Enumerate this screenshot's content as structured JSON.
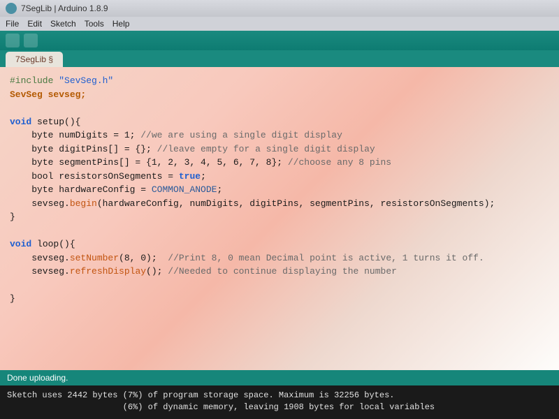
{
  "title_bar": {
    "title": "7SegLib | Arduino 1.8.9"
  },
  "menu": {
    "file": "File",
    "edit": "Edit",
    "sketch": "Sketch",
    "tools": "Tools",
    "help": "Help"
  },
  "tab": {
    "name": "7SegLib §"
  },
  "code": {
    "line1_pre": "#include ",
    "line1_str": "\"SevSeg.h\"",
    "line2": "SevSeg sevseg;",
    "blank": "",
    "setup_decl_kw": "void",
    "setup_decl_name": " setup(){",
    "setup_l1_a": "    byte numDigits = 1; ",
    "setup_l1_c": "//we are using a single digit display",
    "setup_l2_a": "    byte digitPins[] = {}; ",
    "setup_l2_c": "//leave empty for a single digit display",
    "setup_l3_a": "    byte segmentPins[] = {1, 2, 3, 4, 5, 6, 7, 8}; ",
    "setup_l3_c": "//choose any 8 pins",
    "setup_l4_a": "    bool resistorsOnSegments = ",
    "setup_l4_b": "true",
    "setup_l4_c": ";",
    "setup_l5_a": "    byte hardwareConfig = ",
    "setup_l5_b": "COMMON_ANODE",
    "setup_l5_c": ";",
    "setup_l6_a": "    sevseg.",
    "setup_l6_m": "begin",
    "setup_l6_b": "(hardwareConfig, numDigits, digitPins, segmentPins, resistorsOnSegments);",
    "setup_close": "}",
    "loop_decl_kw": "void",
    "loop_decl_name": " loop(){",
    "loop_l1_a": "    sevseg.",
    "loop_l1_m": "setNumber",
    "loop_l1_b": "(8, 0);  ",
    "loop_l1_c": "//Print 8, 0 mean Decimal point is active, 1 turns it off.",
    "loop_l2_a": "    sevseg.",
    "loop_l2_m": "refreshDisplay",
    "loop_l2_b": "(); ",
    "loop_l2_c": "//Needed to continue displaying the number",
    "loop_close": "}"
  },
  "status": {
    "text": "Done uploading."
  },
  "console": {
    "line1": "Sketch uses 2442 bytes (7%) of program storage space. Maximum is 32256 bytes.",
    "line2": "                       (6%) of dynamic memory, leaving 1908 bytes for local variables"
  }
}
